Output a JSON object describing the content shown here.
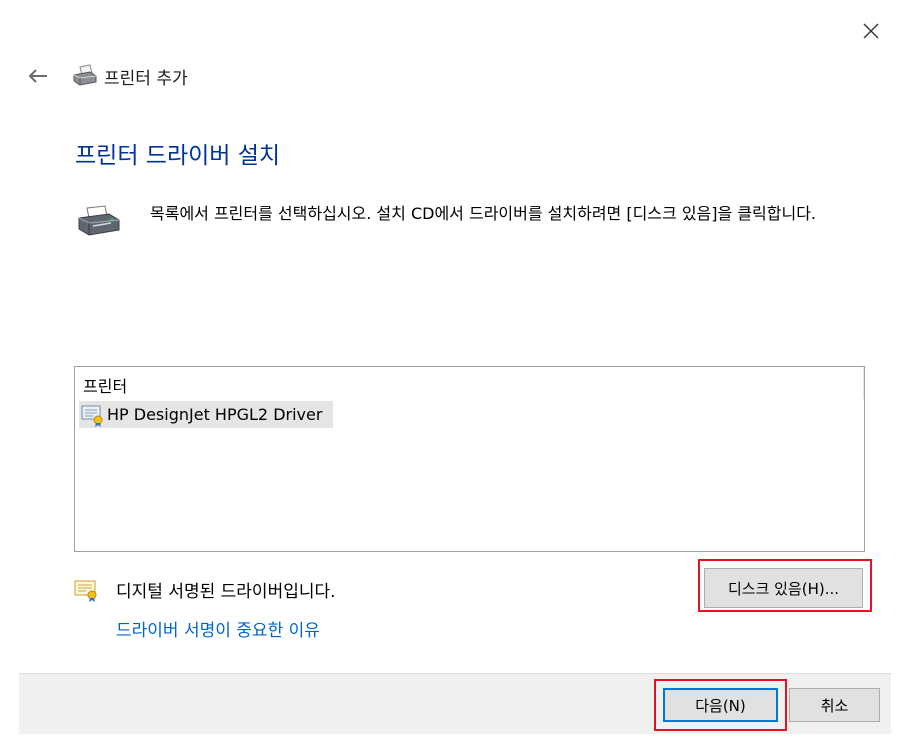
{
  "window": {
    "close_icon": "close-icon",
    "back_icon": "back-arrow-icon",
    "title_icon": "printer-icon",
    "title": "프린터 추가"
  },
  "main": {
    "heading": "프린터 드라이버 설치",
    "description_icon": "printer-icon",
    "description": "목록에서 프린터를 선택하십시오. 설치 CD에서 드라이버를 설치하려면 [디스크 있음]을 클릭합니다."
  },
  "printer_list": {
    "header": "프린터",
    "items": [
      {
        "label": "HP DesignJet HPGL2 Driver",
        "icon": "certified-driver-icon",
        "selected": true
      }
    ]
  },
  "signature": {
    "icon": "certificate-icon",
    "text": "디지털 서명된 드라이버입니다.",
    "link": "드라이버 서명이 중요한 이유"
  },
  "buttons": {
    "have_disk": "디스크 있음(H)...",
    "next": "다음(N)",
    "cancel": "취소"
  },
  "colors": {
    "heading": "#003399",
    "link": "#0066cc",
    "highlight_box": "#e81123",
    "default_button_border": "#0078d7"
  }
}
